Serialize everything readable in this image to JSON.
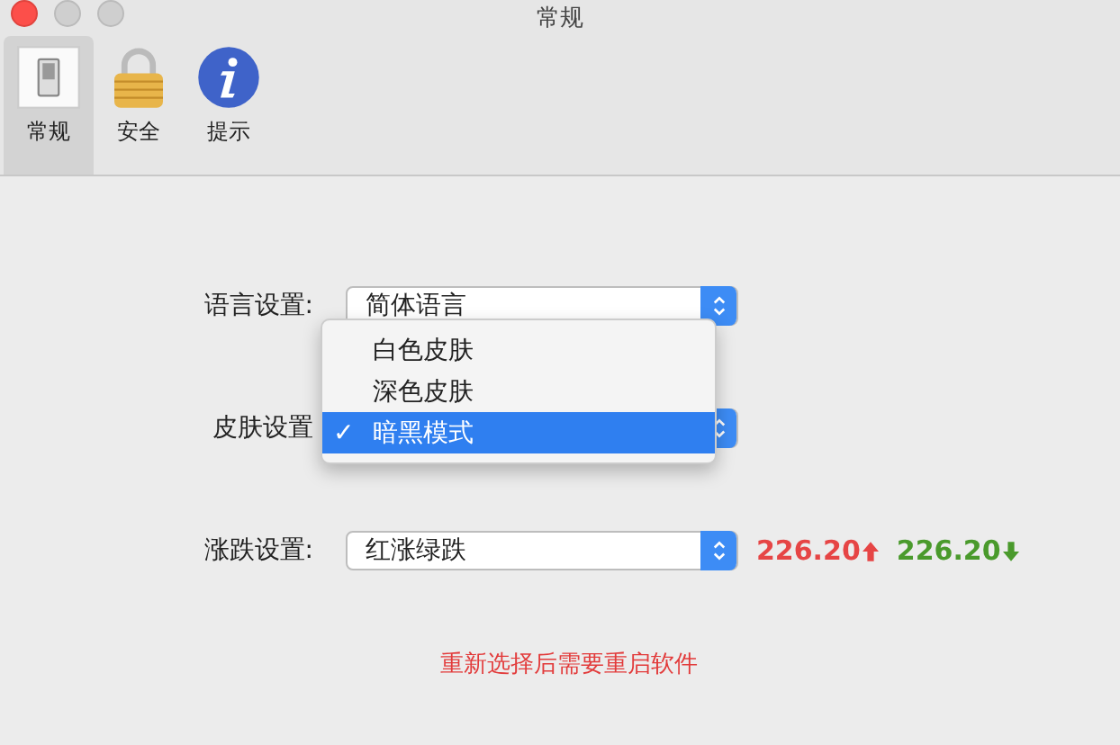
{
  "window": {
    "title": "常规"
  },
  "tabs": [
    {
      "label": "常规",
      "kind": "switch",
      "selected": true
    },
    {
      "label": "安全",
      "kind": "lock",
      "selected": false
    },
    {
      "label": "提示",
      "kind": "info",
      "selected": false
    }
  ],
  "settings": [
    {
      "label": "语言设置:",
      "value": "简体语言",
      "kind": "select"
    },
    {
      "label": "皮肤设置",
      "kind": "covered"
    },
    {
      "label": "涨跌设置:",
      "value": "红涨绿跌",
      "kind": "select",
      "previews": [
        {
          "text": "226.20",
          "kind": "up"
        },
        {
          "text": "226.20",
          "kind": "down"
        }
      ]
    }
  ],
  "skin_menu": [
    {
      "label": "白色皮肤",
      "selected": false
    },
    {
      "label": "深色皮肤",
      "selected": false
    },
    {
      "label": "暗黑模式",
      "selected": true
    }
  ],
  "menu_check": "✓",
  "note": "重新选择后需要重启软件"
}
